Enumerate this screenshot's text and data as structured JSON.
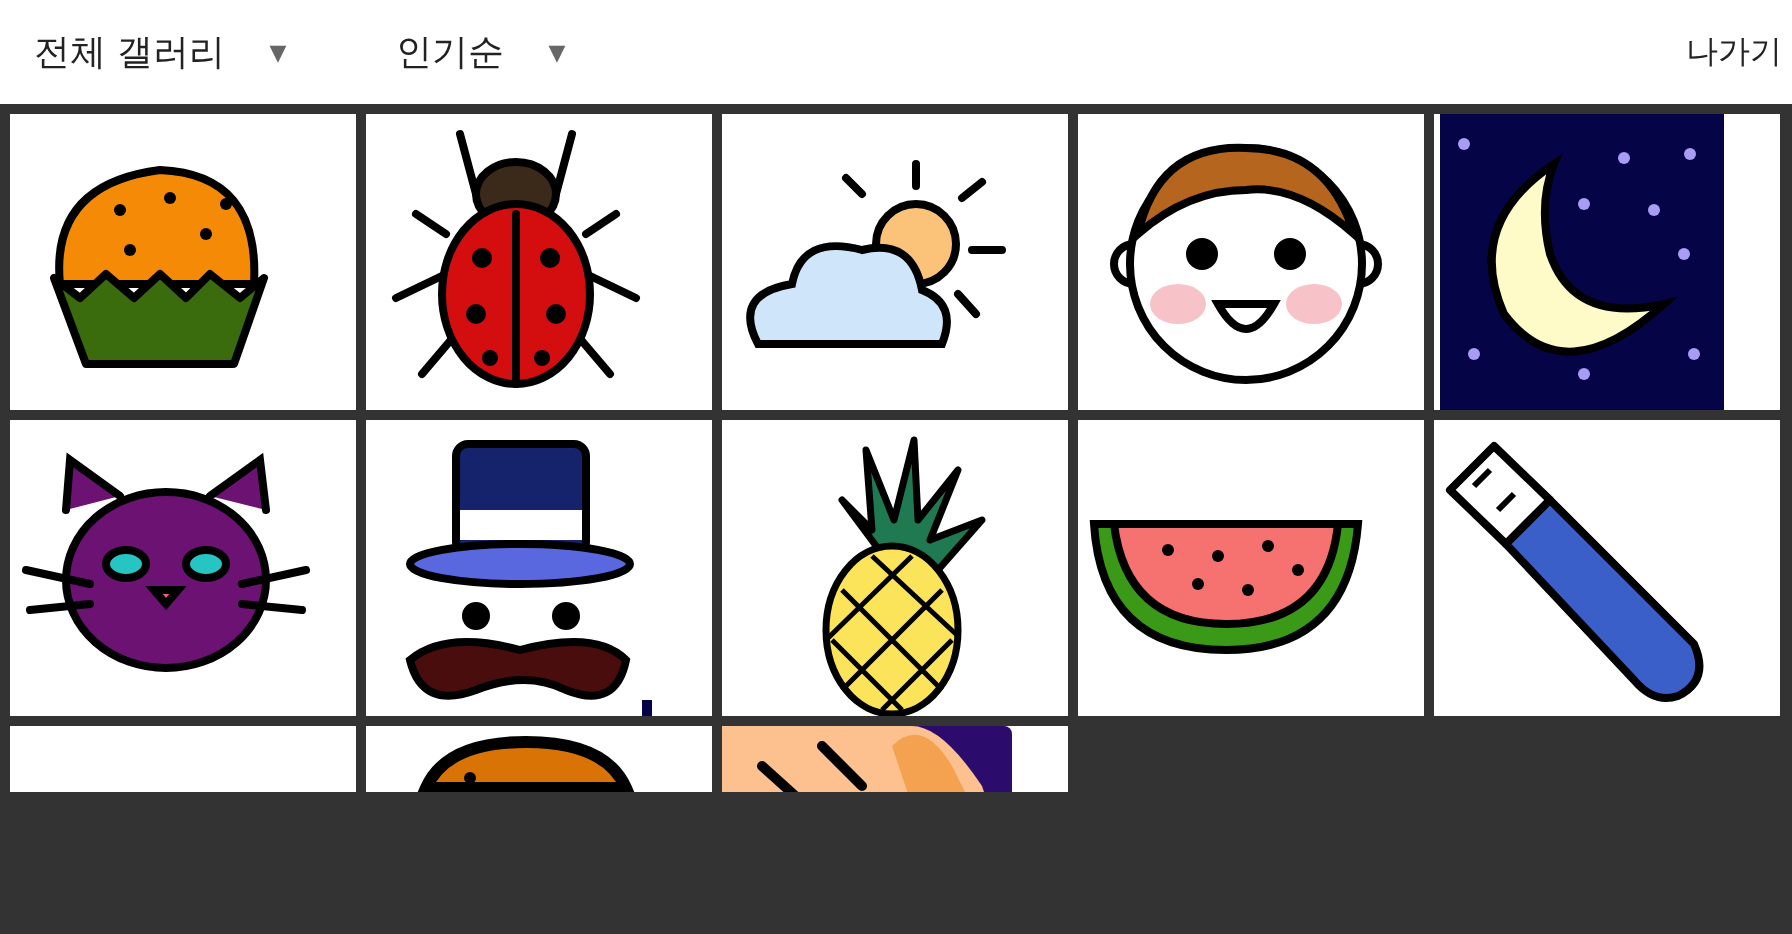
{
  "toolbar": {
    "dropdowns": [
      {
        "label": "전체 갤러리",
        "caret": "▼"
      },
      {
        "label": "인기순",
        "caret": "▼"
      }
    ],
    "exit_button": "나가기"
  },
  "gallery": [
    {
      "kind": "cupcake"
    },
    {
      "kind": "ladybug"
    },
    {
      "kind": "cloud-sun"
    },
    {
      "kind": "baby"
    },
    {
      "kind": "moon"
    },
    {
      "kind": "cat"
    },
    {
      "kind": "top-hat"
    },
    {
      "kind": "pineapple"
    },
    {
      "kind": "watermelon"
    },
    {
      "kind": "usb"
    },
    {
      "kind": "blank"
    },
    {
      "kind": "bun"
    },
    {
      "kind": "hand"
    }
  ]
}
